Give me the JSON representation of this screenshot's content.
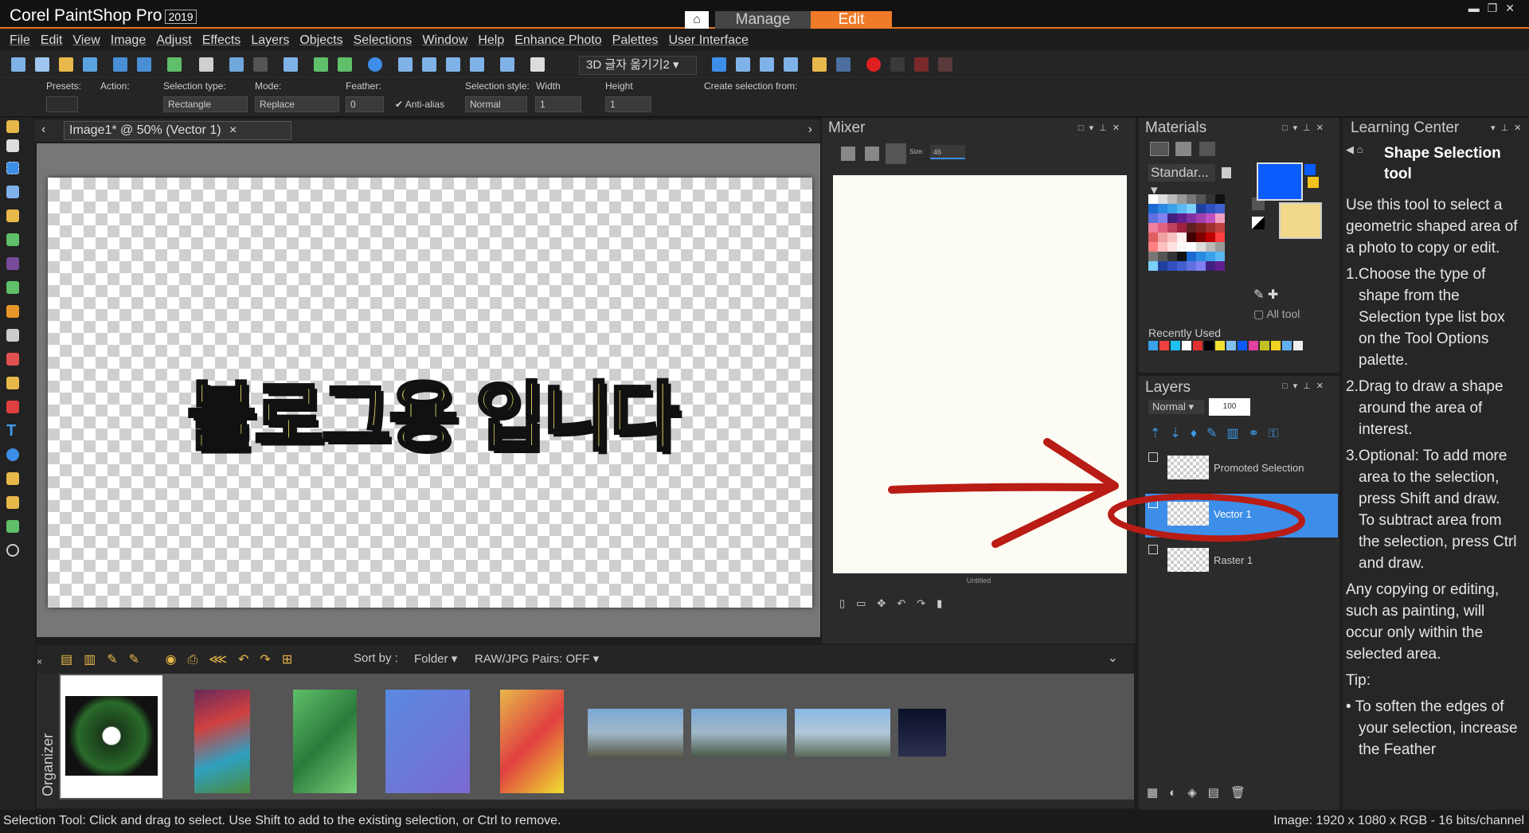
{
  "app": {
    "brand": "Corel PaintShop Pro",
    "version": "2019",
    "workspace_tabs": [
      "Manage",
      "Edit"
    ]
  },
  "menu": [
    "File",
    "Edit",
    "View",
    "Image",
    "Adjust",
    "Effects",
    "Layers",
    "Objects",
    "Selections",
    "Window",
    "Help",
    "Enhance Photo",
    "Palettes",
    "User Interface"
  ],
  "toolbar": {
    "preset_name": "3D 글자 옮기기2"
  },
  "tool_options": {
    "presets_label": "Presets:",
    "action_label": "Action:",
    "selection_type_label": "Selection type:",
    "selection_type_value": "Rectangle",
    "mode_label": "Mode:",
    "mode_value": "Replace",
    "feather_label": "Feather:",
    "feather_value": "0",
    "antialias_label": "Anti-alias",
    "selection_style_label": "Selection style:",
    "selection_style_value": "Normal",
    "width_label": "Width",
    "width_value": "1",
    "height_label": "Height",
    "height_value": "1",
    "create_from_label": "Create selection from:"
  },
  "document": {
    "tab_title": "Image1* @  50% (Vector 1)",
    "canvas_text": "블로그용 입니다"
  },
  "mixer": {
    "title": "Mixer",
    "size_label": "Size:",
    "size_value": "46",
    "canvas_caption": "Untitled"
  },
  "materials": {
    "title": "Materials",
    "swatch_set": "Standar...",
    "all_tools_label": "All tool",
    "recently_used_label": "Recently Used",
    "foreground_color": "#0a5cff"
  },
  "layers": {
    "title": "Layers",
    "blend_mode": "Normal",
    "opacity": "100",
    "items": [
      {
        "name": "Promoted Selection",
        "selected": false
      },
      {
        "name": "Vector 1",
        "selected": true
      },
      {
        "name": "Raster 1",
        "selected": false
      }
    ]
  },
  "learning_center": {
    "title": "Learning Center",
    "heading": "Shape Selection tool",
    "intro": "Use this tool to select a geometric shaped area of a photo to copy or edit.",
    "steps": [
      "1.Choose the type of shape from the Selection type list box on the Tool Options palette.",
      "2.Drag to draw a shape around the area of interest.",
      "3.Optional: To add more area to the selection, press Shift and draw. To subtract area from the selection, press Ctrl and draw."
    ],
    "note": "Any copying or editing, such as painting, will occur only within the selected area.",
    "tip_label": "Tip:",
    "tip": "To soften the edges of your selection, increase the Feather"
  },
  "organizer": {
    "label": "Organizer",
    "sort_label": "Sort by :",
    "sort_value": "Folder",
    "raw_pairs": "RAW/JPG Pairs: OFF"
  },
  "status": {
    "left": "Selection Tool: Click and drag to select. Use Shift to add to the existing selection, or Ctrl to remove.",
    "right": "Image:  1920 x 1080 x RGB - 16 bits/channel"
  },
  "colors": {
    "accent": "#ef7b28",
    "layer_selected": "#3d8ee8",
    "annotation": "#b81c14"
  }
}
